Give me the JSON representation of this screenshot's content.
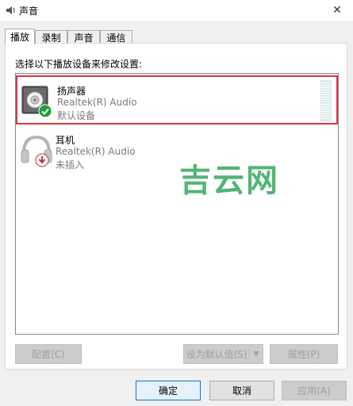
{
  "window": {
    "title": "声音",
    "close_glyph": "✕"
  },
  "tabs": [
    {
      "label": "播放",
      "active": true
    },
    {
      "label": "录制",
      "active": false
    },
    {
      "label": "声音",
      "active": false
    },
    {
      "label": "通信",
      "active": false
    }
  ],
  "panel": {
    "instruction": "选择以下播放设备来修改设置:",
    "devices": [
      {
        "name": "扬声器",
        "driver": "Realtek(R) Audio",
        "status": "默认设备",
        "icon": "speaker-icon",
        "badge": "green-check-icon",
        "selected": true
      },
      {
        "name": "耳机",
        "driver": "Realtek(R) Audio",
        "status": "未插入",
        "icon": "headphones-icon",
        "badge": "red-down-arrow-icon",
        "selected": false
      }
    ],
    "watermark": "吉云网",
    "buttons": {
      "configure": "配置(C)",
      "set_default": "设为默认值(S)",
      "properties": "属性(P)"
    }
  },
  "footer": {
    "ok": "确定",
    "cancel": "取消",
    "apply": "应用(A)"
  },
  "colors": {
    "selection_border": "#d9363e",
    "check_green": "#1e9e3a",
    "watermark_green": "#3fae65"
  }
}
